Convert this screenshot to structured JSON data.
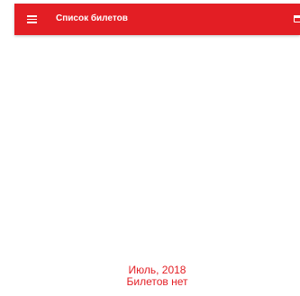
{
  "appbar": {
    "title": "Список билетов",
    "menu_icon": "hamburger-menu-icon",
    "calendar_icon": "calendar-icon",
    "color": "#e31e24"
  },
  "empty_state": {
    "month": "Июль, 2018",
    "message": "Билетов нет",
    "color": "#e31e24"
  }
}
